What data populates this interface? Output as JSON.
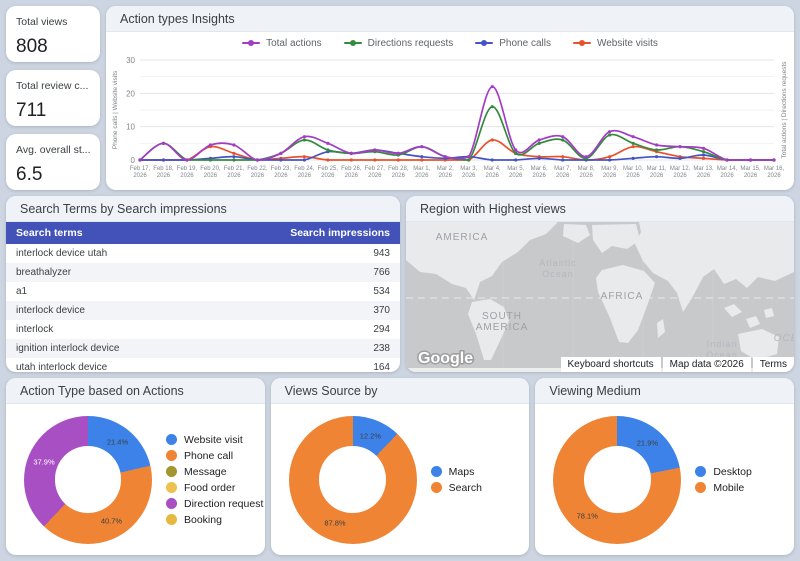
{
  "colors": {
    "page_bg": "#ccd5e1",
    "table_header_bg": "#4252b8",
    "card_header_bg": "#eff3f8"
  },
  "kpis": [
    {
      "label": "Total views",
      "value": "808"
    },
    {
      "label": "Total review c...",
      "value": "711"
    },
    {
      "label": "Avg. overall st...",
      "value": "6.5"
    }
  ],
  "cards": {
    "search_table_title": "Search Terms by Search impressions",
    "map_title": "Region with Highest views"
  },
  "search_table": {
    "columns": [
      "Search terms",
      "Search impressions"
    ],
    "rows": [
      [
        "interlock device utah",
        "943"
      ],
      [
        "breathalyzer",
        "766"
      ],
      [
        "a1",
        "534"
      ],
      [
        "interlock device",
        "370"
      ],
      [
        "interlock",
        "294"
      ],
      [
        "ignition interlock device",
        "238"
      ],
      [
        "utah interlock device",
        "164"
      ]
    ]
  },
  "map": {
    "labels": {
      "america": "AMERICA",
      "atlantic1": "Atlantic",
      "atlantic2": "Ocean",
      "africa": "AFRICA",
      "south1": "SOUTH",
      "south2": "AMERICA",
      "indian1": "Indian",
      "indian2": "Ocean",
      "ocean": "OCEAN"
    },
    "google": "Google",
    "footer": [
      "Keyboard shortcuts",
      "Map data ©2026",
      "Terms"
    ]
  },
  "chart_data": [
    {
      "type": "line",
      "title": "Action types Insights",
      "x": [
        "Feb 17, 2026",
        "Feb 18, 2026",
        "Feb 19, 2026",
        "Feb 20, 2026",
        "Feb 21, 2026",
        "Feb 22, 2026",
        "Feb 23, 2026",
        "Feb 24, 2026",
        "Feb 25, 2026",
        "Feb 26, 2026",
        "Feb 27, 2026",
        "Feb 28, 2026",
        "Mar 1, 2026",
        "Mar 2, 2026",
        "Mar 3, 2026",
        "Mar 4, 2026",
        "Mar 5, 2026",
        "Mar 6, 2026",
        "Mar 7, 2026",
        "Mar 8, 2026",
        "Mar 9, 2026",
        "Mar 10, 2026",
        "Mar 11, 2026",
        "Mar 12, 2026",
        "Mar 13, 2026",
        "Mar 14, 2026",
        "Mar 15, 2026",
        "Mar 16, 2026"
      ],
      "series": [
        {
          "name": "Total actions",
          "color": "#a43bc4",
          "values": [
            0,
            5,
            0,
            4.5,
            4.5,
            0,
            2,
            7,
            5,
            2,
            3,
            2,
            4,
            1,
            1,
            22,
            3,
            6,
            7,
            1,
            8.5,
            7,
            4.5,
            4,
            3.5,
            0,
            0,
            0
          ]
        },
        {
          "name": "Directions requests",
          "color": "#358a3f",
          "values": [
            0,
            5,
            0,
            0,
            0,
            0,
            2,
            6,
            3,
            2,
            2.5,
            1.5,
            4,
            1,
            0,
            16,
            2,
            5,
            6,
            0.5,
            7.5,
            5,
            3,
            4,
            2.5,
            0,
            0,
            0
          ]
        },
        {
          "name": "Phone calls",
          "color": "#4453c5",
          "values": [
            0,
            0,
            0,
            0.5,
            1,
            0,
            0,
            0,
            2.5,
            2,
            3,
            2,
            1,
            0.5,
            1,
            0,
            0,
            0.5,
            0,
            0,
            0,
            0.5,
            1,
            0.5,
            1.5,
            0,
            0,
            0
          ]
        },
        {
          "name": "Website visits",
          "color": "#e8512c",
          "values": [
            0,
            0,
            0,
            4,
            2,
            0,
            0.5,
            1,
            0,
            0,
            0,
            0,
            0,
            0,
            0,
            6,
            2,
            1,
            1,
            0,
            1,
            4,
            2.5,
            1,
            0.5,
            0,
            0,
            0
          ]
        }
      ],
      "ylabel_left": "Phone calls | Website visits",
      "ylabel_right": "Total actions | Directions requests",
      "ylim": [
        0,
        30
      ],
      "y_ticks": [
        0,
        10,
        20,
        30
      ],
      "grid": true,
      "legend_position": "top"
    },
    {
      "type": "pie",
      "title": "Action Type based on Actions",
      "labels": [
        "Website visit",
        "Phone call",
        "Message",
        "Food order",
        "Direction request",
        "Booking"
      ],
      "values": [
        21.4,
        40.7,
        0,
        0,
        37.9,
        0
      ],
      "colors": [
        "#3d82e8",
        "#ee8434",
        "#a3952f",
        "#eec04d",
        "#a84fc4",
        "#e7b840"
      ],
      "slice_labels": [
        "21.4%",
        "40.7%",
        "",
        "",
        "37.9%",
        ""
      ],
      "label_colors": [
        "#3c4043",
        "#3c4043",
        "",
        "",
        "#ffffff",
        ""
      ],
      "legend_position": "right"
    },
    {
      "type": "pie",
      "title": "Views Source by",
      "labels": [
        "Maps",
        "Search"
      ],
      "values": [
        12.2,
        87.8
      ],
      "colors": [
        "#3d82e8",
        "#ee8434"
      ],
      "slice_labels": [
        "12.2%",
        "87.8%"
      ],
      "label_colors": [
        "#3c4043",
        "#3c4043"
      ],
      "legend_position": "right"
    },
    {
      "type": "pie",
      "title": "Viewing Medium",
      "labels": [
        "Desktop",
        "Mobile"
      ],
      "values": [
        21.9,
        78.1
      ],
      "colors": [
        "#3d82e8",
        "#ee8434"
      ],
      "slice_labels": [
        "21.9%",
        "78.1%"
      ],
      "label_colors": [
        "#3c4043",
        "#3c4043"
      ],
      "legend_position": "right"
    }
  ]
}
